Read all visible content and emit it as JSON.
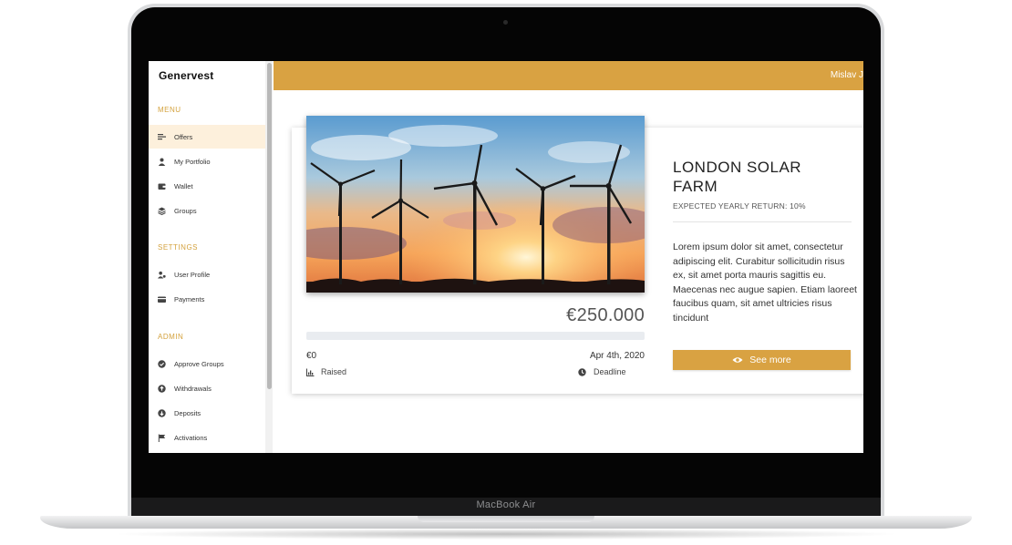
{
  "device": {
    "label": "MacBook Air"
  },
  "app": {
    "name": "Genervest"
  },
  "header": {
    "user_name": "Mislav J"
  },
  "sidebar": {
    "sections": [
      {
        "title": "MENU",
        "items": [
          {
            "label": "Offers",
            "icon": "list-icon",
            "active": true
          },
          {
            "label": "My Portfolio",
            "icon": "user-icon"
          },
          {
            "label": "Wallet",
            "icon": "wallet-icon"
          },
          {
            "label": "Groups",
            "icon": "layers-icon"
          }
        ]
      },
      {
        "title": "SETTINGS",
        "items": [
          {
            "label": "User Profile",
            "icon": "user-cog-icon"
          },
          {
            "label": "Payments",
            "icon": "credit-card-icon"
          }
        ]
      },
      {
        "title": "ADMIN",
        "items": [
          {
            "label": "Approve Groups",
            "icon": "check-circle-icon"
          },
          {
            "label": "Withdrawals",
            "icon": "arrow-up-circle-icon"
          },
          {
            "label": "Deposits",
            "icon": "arrow-down-circle-icon"
          },
          {
            "label": "Activations",
            "icon": "flag-icon"
          }
        ]
      }
    ]
  },
  "offer": {
    "title": "LONDON SOLAR FARM",
    "expected_return": "EXPECTED YEARLY RETURN: 10%",
    "description": "Lorem ipsum dolor sit amet, consectetur adipiscing elit. Curabitur sollicitudin risus ex, sit amet porta mauris sagittis eu. Maecenas nec augue sapien. Etiam laoreet faucibus quam, sit amet ultricies risus tincidunt",
    "goal_amount": "€250.000",
    "raised_amount": "€0",
    "raised_label": "Raised",
    "raised_fraction": 0,
    "deadline": "Apr 4th, 2020",
    "deadline_label": "Deadline",
    "see_more_label": "See more",
    "image": "wind-turbines-sunset"
  },
  "colors": {
    "accent": "#d9a242",
    "active_bg": "#fdf0dc",
    "section_title": "#d4a23e"
  }
}
